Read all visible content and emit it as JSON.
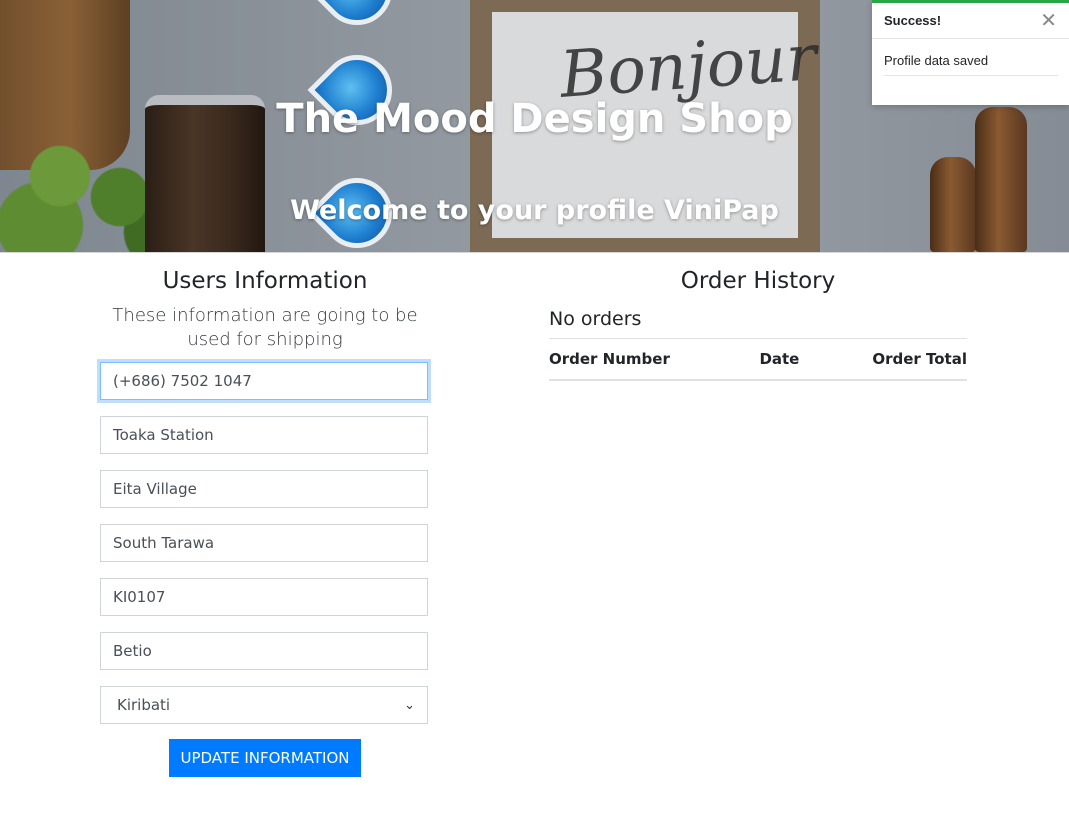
{
  "hero": {
    "title": "The Mood Design Shop",
    "subtitle": "Welcome to your profile ViniPap",
    "frame_text": "Bonjour"
  },
  "toast": {
    "title": "Success!",
    "message": "Profile data saved",
    "close_icon": "close-icon",
    "accent_color": "#28a745"
  },
  "users": {
    "title": "Users Information",
    "subtitle": "These information are going to be used for shipping",
    "fields": {
      "phone": "(+686) 7502 1047",
      "address": "Toaka Station",
      "address2": "Eita Village",
      "city": "South Tarawa",
      "postcode": "KI0107",
      "region": "Betio",
      "country": "Kiribati"
    },
    "update_button": "UPDATE INFORMATION"
  },
  "orders": {
    "title": "Order History",
    "empty_text": "No orders",
    "columns": [
      "Order Number",
      "Date",
      "Order Total"
    ]
  },
  "colors": {
    "primary": "#007bff",
    "success": "#28a745"
  }
}
